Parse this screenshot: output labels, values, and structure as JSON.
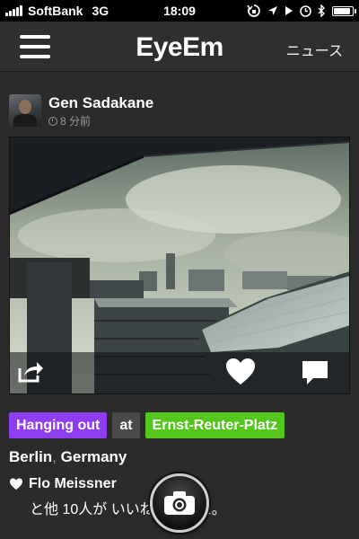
{
  "status_bar": {
    "carrier": "SoftBank",
    "network": "3G",
    "time": "18:09",
    "battery_level": 0.9,
    "icons": [
      "signal-icon",
      "rotation-lock-icon",
      "location-arrow-icon",
      "play-icon",
      "alarm-icon",
      "bluetooth-icon",
      "battery-icon"
    ]
  },
  "nav": {
    "title": "EyeEm",
    "news_label": "ニュース",
    "menu_icon": "hamburger-menu-icon"
  },
  "post": {
    "user_name": "Gen Sadakane",
    "time_ago": "8 分前",
    "topic_tag": "Hanging out",
    "at_label": "at",
    "venue_tag": "Ernst-Reuter-Platz",
    "city": "Berlin",
    "separator": ",",
    "country": "Germany",
    "liker": "Flo Meissner",
    "likes_summary": "と他 10人が いいねしました。"
  },
  "colors": {
    "background": "#2b2b2b",
    "navbar": "#2f2f2f",
    "topic_tag": "#8f3df0",
    "at_tag": "#4a4a4a",
    "venue_tag": "#52c61a"
  },
  "icons": {
    "share": "share-icon",
    "like": "heart-icon",
    "comment": "comment-bubble-icon",
    "camera": "camera-icon",
    "clock": "clock-icon"
  }
}
